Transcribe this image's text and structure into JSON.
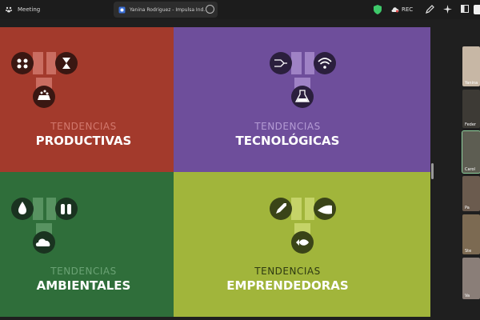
{
  "topbar": {
    "meeting_label": "Meeting",
    "share_title": "Yanina Rodriguez - Impulsa Ind...",
    "rec_label": "REC"
  },
  "quadrants": [
    {
      "line1": "TENDENCIAS",
      "line2": "PRODUCTIVAS",
      "bg": "#a33a2c",
      "line1_color": "#d2786d"
    },
    {
      "line1": "TENDENCIAS",
      "line2": "TECNOLÓGICAS",
      "bg": "#6e4e9b",
      "line1_color": "#b49bd4"
    },
    {
      "line1": "TENDENCIAS",
      "line2": "AMBIENTALES",
      "bg": "#2f6e3a",
      "line1_color": "#6aa274"
    },
    {
      "line1": "TENDENCIAS",
      "line2": "EMPRENDEDORAS",
      "bg": "#a1b53b",
      "line1_color": "#2e3a12"
    }
  ],
  "participants": [
    {
      "name": "Yanina"
    },
    {
      "name": "Feder"
    },
    {
      "name": "Carol"
    },
    {
      "name": "Pa"
    },
    {
      "name": "Ste"
    },
    {
      "name": "Va"
    }
  ]
}
